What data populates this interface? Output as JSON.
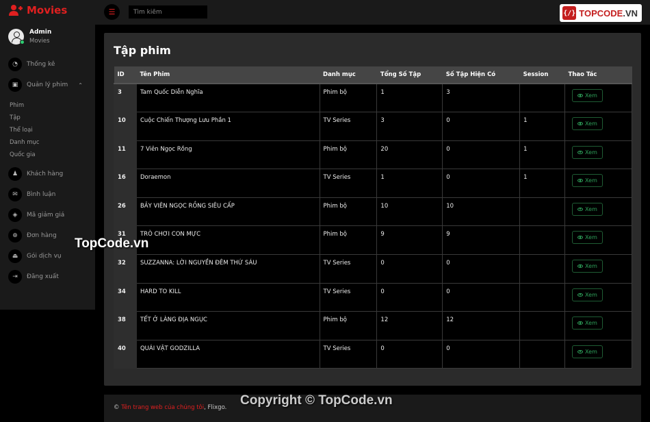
{
  "brand": {
    "name": "Movies",
    "icon": "user-icon"
  },
  "topbar": {
    "menu_icon": "hamburger-icon",
    "search_placeholder": "Tìm kiếm"
  },
  "logo": {
    "mark": "{/}",
    "text_main": "TOPCODE",
    "text_suffix": ".VN"
  },
  "user": {
    "name": "Admin",
    "role": "Movies",
    "status_color": "#2ecc71"
  },
  "nav": [
    {
      "label": "Thống kê",
      "icon": "dashboard-icon"
    },
    {
      "label": "Quản lý phim",
      "icon": "film-icon"
    },
    {
      "label": "Khách hàng",
      "icon": "users-icon"
    },
    {
      "label": "Bình luận",
      "icon": "comments-icon"
    },
    {
      "label": "Mã giảm giá",
      "icon": "tags-icon"
    },
    {
      "label": "Đơn hàng",
      "icon": "cart-icon"
    },
    {
      "label": "Gói dịch vụ",
      "icon": "eject-icon"
    },
    {
      "label": "Đăng xuất",
      "icon": "signout-icon"
    }
  ],
  "subnav": [
    "Phim",
    "Tập",
    "Thể loại",
    "Danh mục",
    "Quốc gia"
  ],
  "page": {
    "title": "Tập phim"
  },
  "table": {
    "headers": [
      "ID",
      "Tên Phim",
      "Danh mục",
      "Tổng Số Tập",
      "Số Tập Hiện Có",
      "Session",
      "Thao Tác"
    ],
    "action_label": "Xem",
    "rows": [
      {
        "id": "3",
        "name": "Tam Quốc Diễn Nghĩa",
        "category": "Phim bộ",
        "total": "1",
        "current": "3",
        "session": ""
      },
      {
        "id": "10",
        "name": "Cuộc Chiến Thượng Lưu Phần 1",
        "category": "TV Series",
        "total": "3",
        "current": "0",
        "session": "1"
      },
      {
        "id": "11",
        "name": "7 Viên Ngọc Rồng",
        "category": "Phim bộ",
        "total": "20",
        "current": "0",
        "session": "1"
      },
      {
        "id": "16",
        "name": "Doraemon",
        "category": "TV Series",
        "total": "1",
        "current": "0",
        "session": "1"
      },
      {
        "id": "26",
        "name": "BẢY VIÊN NGỌC RỒNG SIÊU CẤP",
        "category": "Phim bộ",
        "total": "10",
        "current": "10",
        "session": ""
      },
      {
        "id": "31",
        "name": "TRÒ CHƠI CON MỰC",
        "category": "Phim bộ",
        "total": "9",
        "current": "9",
        "session": ""
      },
      {
        "id": "32",
        "name": "SUZZANNA: LỜI NGUYỀN ĐÊM THỨ SÁU",
        "category": "TV Series",
        "total": "0",
        "current": "0",
        "session": ""
      },
      {
        "id": "34",
        "name": "HARD TO KILL",
        "category": "TV Series",
        "total": "0",
        "current": "0",
        "session": ""
      },
      {
        "id": "38",
        "name": "TẾT Ở LÀNG ĐỊA NGỤC",
        "category": "Phim bộ",
        "total": "12",
        "current": "12",
        "session": ""
      },
      {
        "id": "40",
        "name": "QUÁI VẬT GODZILLA",
        "category": "TV Series",
        "total": "0",
        "current": "0",
        "session": ""
      }
    ]
  },
  "footer": {
    "symbol": "©",
    "link_text": "Tên trang web của chúng tôi",
    "suffix": ", Flixgo."
  },
  "watermarks": {
    "side": "TopCode.vn",
    "bottom": "Copyright © TopCode.vn"
  },
  "colors": {
    "accent": "#e02020",
    "success": "#2ea05a"
  }
}
